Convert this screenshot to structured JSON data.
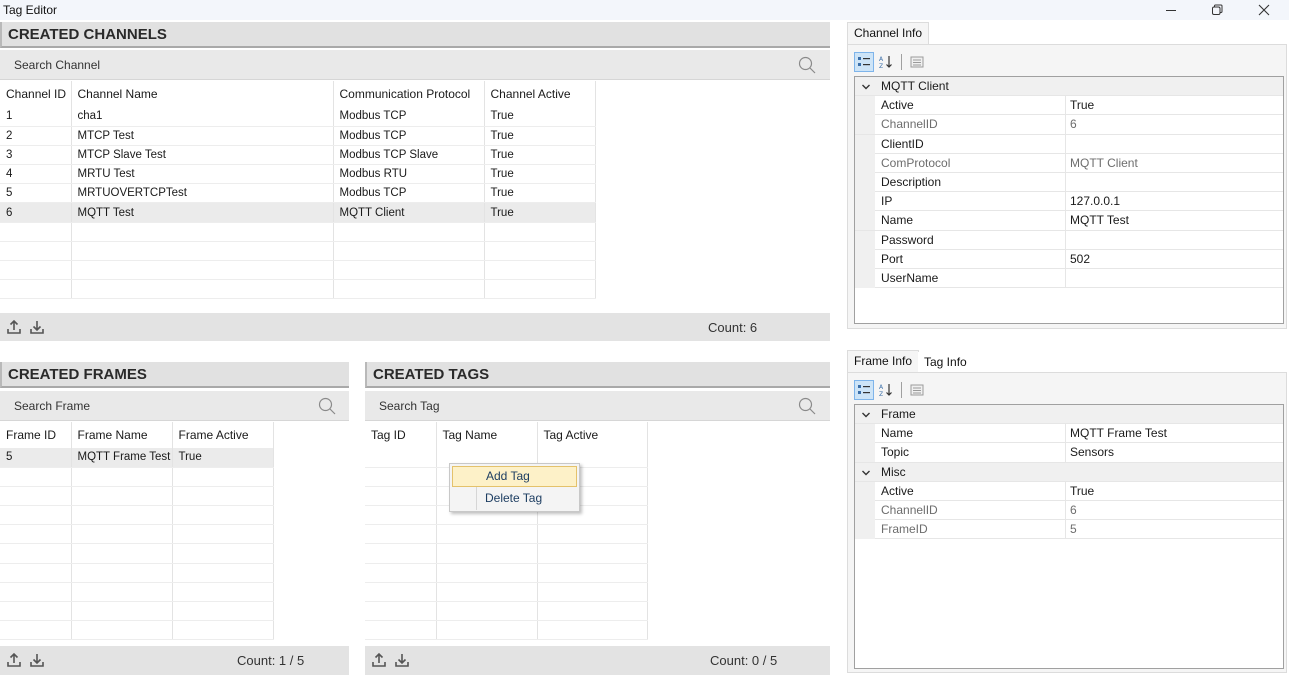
{
  "window": {
    "title": "Tag Editor"
  },
  "channels": {
    "header": "CREATED CHANNELS",
    "search_placeholder": "Search Channel",
    "columns": [
      "Channel ID",
      "Channel Name",
      "Communication Protocol",
      "Channel Active"
    ],
    "rows": [
      [
        "1",
        "cha1",
        "Modbus TCP",
        "True"
      ],
      [
        "2",
        "MTCP Test",
        "Modbus TCP",
        "True"
      ],
      [
        "3",
        "MTCP Slave Test",
        "Modbus TCP Slave",
        "True"
      ],
      [
        "4",
        "MRTU Test",
        "Modbus RTU",
        "True"
      ],
      [
        "5",
        "MRTUOVERTCPTest",
        "Modbus TCP",
        "True"
      ],
      [
        "6",
        "MQTT Test",
        "MQTT Client",
        "True"
      ]
    ],
    "selected_row": 5,
    "count": "Count: 6"
  },
  "frames": {
    "header": "CREATED FRAMES",
    "search_placeholder": "Search Frame",
    "columns": [
      "Frame ID",
      "Frame Name",
      "Frame Active"
    ],
    "rows": [
      [
        "5",
        "MQTT Frame Test",
        "True"
      ]
    ],
    "selected_row": 0,
    "count": "Count: 1 / 5"
  },
  "tags": {
    "header": "CREATED TAGS",
    "search_placeholder": "Search Tag",
    "columns": [
      "Tag ID",
      "Tag Name",
      "Tag Active"
    ],
    "rows": [],
    "count": "Count: 0 / 5"
  },
  "context_menu": {
    "items": [
      "Add Tag",
      "Delete Tag"
    ],
    "hovered": 0
  },
  "channel_info": {
    "tab": "Channel Info",
    "category": "MQTT Client",
    "props": [
      {
        "label": "Active",
        "value": "True",
        "dim": false
      },
      {
        "label": "ChannelID",
        "value": "6",
        "dim": true
      },
      {
        "label": "ClientID",
        "value": "",
        "dim": false
      },
      {
        "label": "ComProtocol",
        "value": "MQTT Client",
        "dim": true
      },
      {
        "label": "Description",
        "value": "",
        "dim": false
      },
      {
        "label": "IP",
        "value": "127.0.0.1",
        "dim": false
      },
      {
        "label": "Name",
        "value": "MQTT Test",
        "dim": false
      },
      {
        "label": "Password",
        "value": "",
        "dim": false
      },
      {
        "label": "Port",
        "value": "502",
        "dim": false
      },
      {
        "label": "UserName",
        "value": "",
        "dim": false
      }
    ]
  },
  "frame_info": {
    "tabs": [
      "Frame Info",
      "Tag Info"
    ],
    "categories": [
      {
        "name": "Frame",
        "props": [
          {
            "label": "Name",
            "value": "MQTT Frame Test",
            "dim": false
          },
          {
            "label": "Topic",
            "value": "Sensors",
            "dim": false
          }
        ]
      },
      {
        "name": "Misc",
        "props": [
          {
            "label": "Active",
            "value": "True",
            "dim": false
          },
          {
            "label": "ChannelID",
            "value": "6",
            "dim": true
          },
          {
            "label": "FrameID",
            "value": "5",
            "dim": true
          }
        ]
      }
    ]
  },
  "colors": {
    "header_bg": "#e1e1e1",
    "search_bg": "#e9e9e9",
    "selected_row": "#ebebeb",
    "menu_hover": "#fdf1c8",
    "menu_text": "#1e3e62"
  },
  "icons": [
    "minimize-icon",
    "restore-icon",
    "close-icon",
    "search-icon",
    "upload-icon",
    "download-icon",
    "categorized-icon",
    "alphabetical-icon",
    "property-pages-icon",
    "chevron-down-icon"
  ]
}
